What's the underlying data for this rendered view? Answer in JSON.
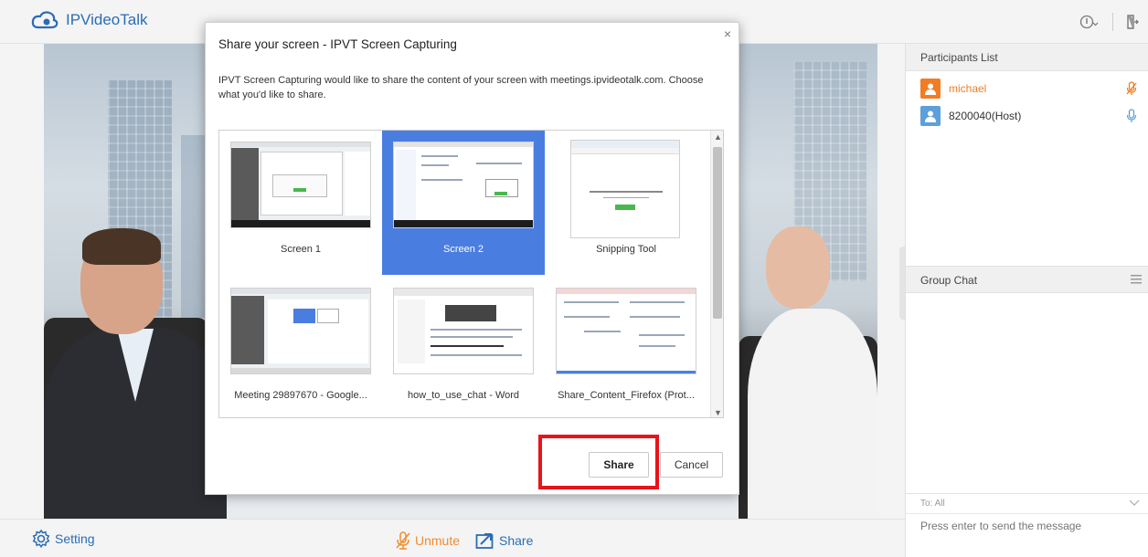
{
  "app": {
    "title": "IPVideoTalk"
  },
  "topbar": {
    "info_icon": "info-circle-icon",
    "exit_icon": "exit-door-icon"
  },
  "dialog": {
    "title": "Share your screen - IPVT Screen Capturing",
    "close": "×",
    "description": "IPVT Screen Capturing would like to share the content of your screen with meetings.ipvideotalk.com. Choose what you'd like to share.",
    "sources": [
      {
        "label": "Screen 1",
        "selected": false
      },
      {
        "label": "Screen 2",
        "selected": true
      },
      {
        "label": "Snipping Tool",
        "selected": false
      },
      {
        "label": "Meeting 29897670 - Google...",
        "selected": false
      },
      {
        "label": "how_to_use_chat - Word",
        "selected": false
      },
      {
        "label": "Share_Content_Firefox (Prot...",
        "selected": false
      }
    ],
    "share_label": "Share",
    "cancel_label": "Cancel"
  },
  "participants": {
    "header": "Participants List",
    "items": [
      {
        "name": "michael",
        "avatar_color": "#f07d24",
        "name_color": "#f07d24",
        "mic_color": "#f07d24"
      },
      {
        "name": "8200040(Host)",
        "avatar_color": "#5d9fd8",
        "name_color": "#333333",
        "mic_color": "#5d9fd8"
      }
    ]
  },
  "chat": {
    "header": "Group Chat",
    "to_label": "To: All",
    "placeholder": "Press enter to send the message"
  },
  "bottombar": {
    "setting_label": "Setting",
    "unmute_label": "Unmute",
    "share_label": "Share"
  },
  "colors": {
    "accent": "#2b6cb5",
    "selected": "#4a7de0",
    "highlight": "#e8141b",
    "orange": "#f07d24"
  }
}
